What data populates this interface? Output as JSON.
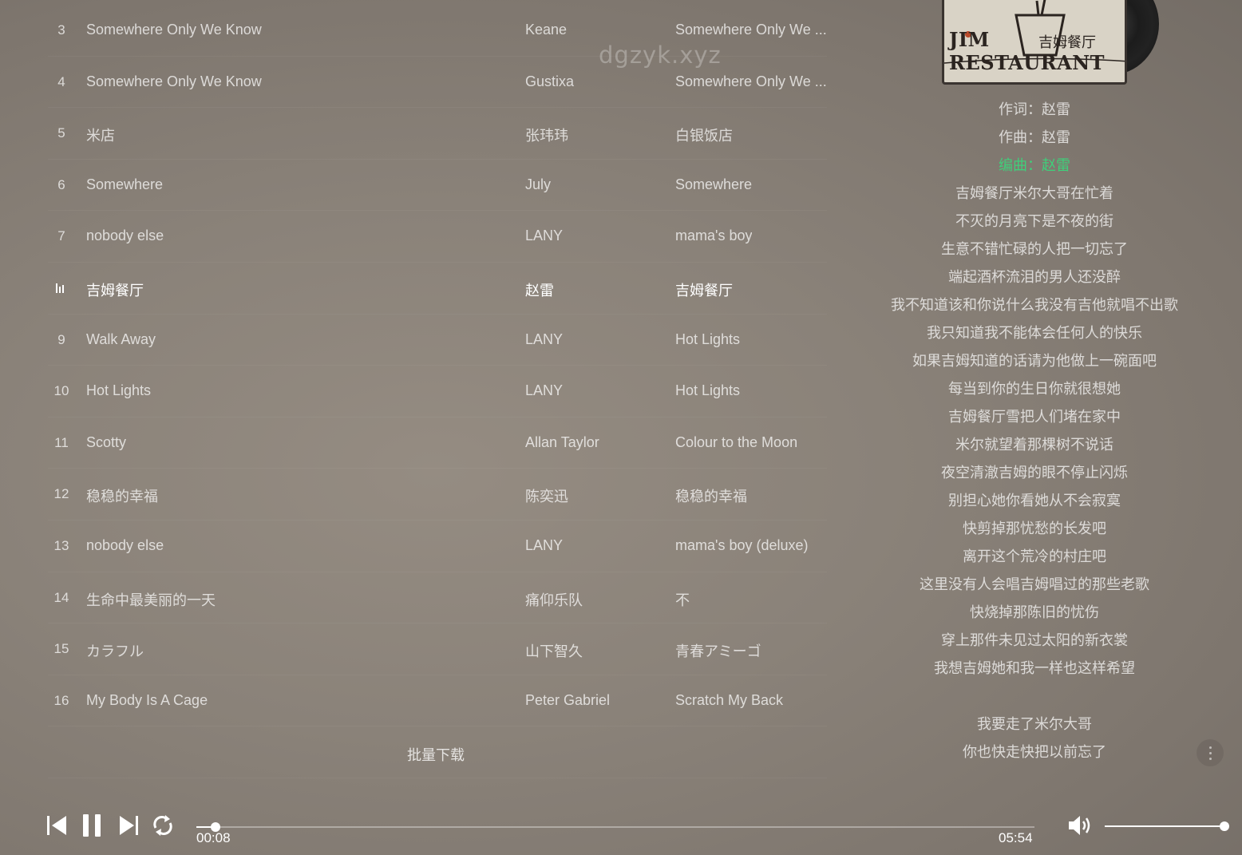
{
  "watermark": "dgzyk.xyz",
  "songs": [
    {
      "num": "3",
      "title": "Somewhere Only We Know",
      "artist": "Keane",
      "album": "Somewhere Only We ..."
    },
    {
      "num": "4",
      "title": "Somewhere Only We Know",
      "artist": "Gustixa",
      "album": "Somewhere Only We ..."
    },
    {
      "num": "5",
      "title": "米店",
      "artist": "张玮玮",
      "album": "白银饭店"
    },
    {
      "num": "6",
      "title": "Somewhere",
      "artist": "July",
      "album": "Somewhere"
    },
    {
      "num": "7",
      "title": "nobody else",
      "artist": "LANY",
      "album": "mama's boy"
    },
    {
      "num": "",
      "title": "吉姆餐厅",
      "artist": "赵雷",
      "album": "吉姆餐厅",
      "playing": true
    },
    {
      "num": "9",
      "title": "Walk Away",
      "artist": "LANY",
      "album": "Hot Lights"
    },
    {
      "num": "10",
      "title": "Hot Lights",
      "artist": "LANY",
      "album": "Hot Lights"
    },
    {
      "num": "11",
      "title": "Scotty",
      "artist": "Allan Taylor",
      "album": "Colour to the Moon"
    },
    {
      "num": "12",
      "title": "稳稳的幸福",
      "artist": "陈奕迅",
      "album": "稳稳的幸福"
    },
    {
      "num": "13",
      "title": "nobody else",
      "artist": "LANY",
      "album": "mama's boy (deluxe)"
    },
    {
      "num": "14",
      "title": "生命中最美丽的一天",
      "artist": "痛仰乐队",
      "album": "不"
    },
    {
      "num": "15",
      "title": "カラフル",
      "artist": "山下智久",
      "album": "青春アミーゴ"
    },
    {
      "num": "16",
      "title": "My Body Is A Cage",
      "artist": "Peter Gabriel",
      "album": "Scratch My Back"
    }
  ],
  "batch_download_label": "批量下载",
  "album_cover": {
    "cn_text": "吉姆餐厅",
    "en_text": "JIM RESTAURANT"
  },
  "lyrics": [
    {
      "text": "作词：赵雷"
    },
    {
      "text": "作曲：赵雷"
    },
    {
      "text": "编曲：赵雷",
      "active": true
    },
    {
      "text": "吉姆餐厅米尔大哥在忙着"
    },
    {
      "text": "不灭的月亮下是不夜的街"
    },
    {
      "text": "生意不错忙碌的人把一切忘了"
    },
    {
      "text": "端起酒杯流泪的男人还没醉"
    },
    {
      "text": "我不知道该和你说什么我没有吉他就唱不出歌"
    },
    {
      "text": "我只知道我不能体会任何人的快乐"
    },
    {
      "text": "如果吉姆知道的话请为他做上一碗面吧"
    },
    {
      "text": "每当到你的生日你就很想她"
    },
    {
      "text": "吉姆餐厅雪把人们堵在家中"
    },
    {
      "text": "米尔就望着那棵树不说话"
    },
    {
      "text": "夜空清澈吉姆的眼不停止闪烁"
    },
    {
      "text": "别担心她你看她从不会寂寞"
    },
    {
      "text": "快剪掉那忧愁的长发吧"
    },
    {
      "text": "离开这个荒冷的村庄吧"
    },
    {
      "text": "这里没有人会唱吉姆唱过的那些老歌"
    },
    {
      "text": "快烧掉那陈旧的忧伤"
    },
    {
      "text": "穿上那件未见过太阳的新衣裳"
    },
    {
      "text": "我想吉姆她和我一样也这样希望"
    },
    {
      "text": ""
    },
    {
      "text": "我要走了米尔大哥"
    },
    {
      "text": "你也快走快把以前忘了"
    }
  ],
  "player": {
    "current_time": "00:08",
    "total_time": "05:54",
    "progress_fraction": 0.023,
    "volume_fraction": 1.0,
    "icons": [
      "previous-icon",
      "pause-icon",
      "next-icon",
      "repeat-icon",
      "volume-icon"
    ]
  },
  "colors": {
    "active_lyric": "#3fcf7a",
    "text": "#ffffff"
  }
}
